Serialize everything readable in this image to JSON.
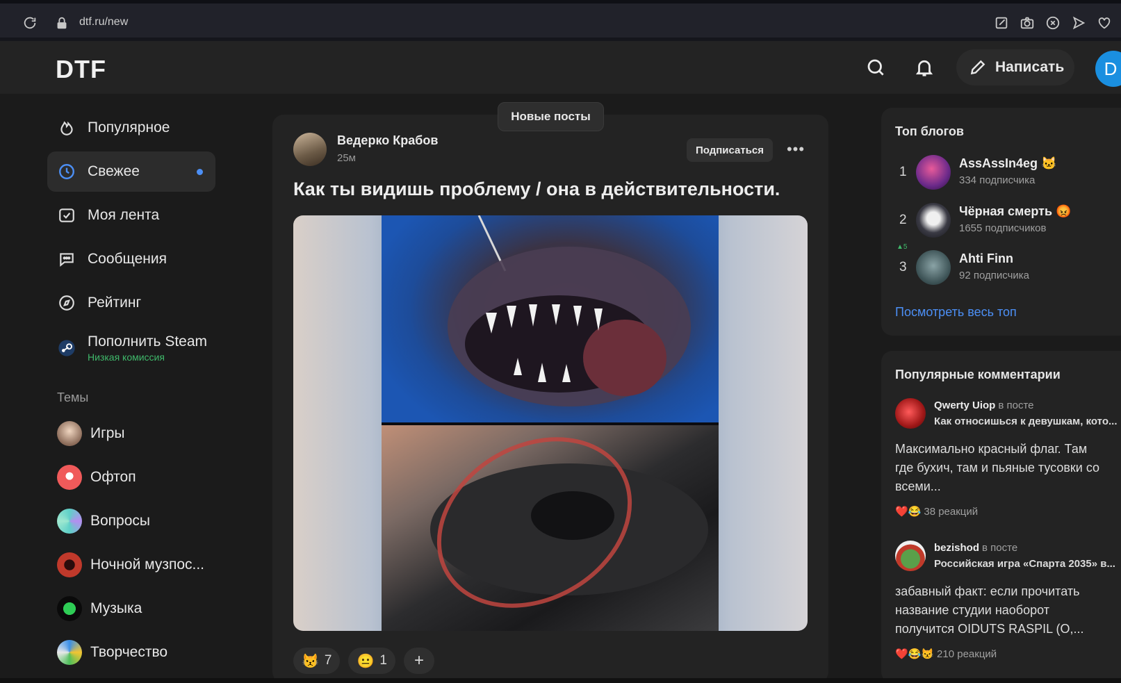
{
  "browser": {
    "url": "dtf.ru/new",
    "icons": [
      "reload-icon",
      "lock-icon",
      "edit-icon",
      "camera-icon",
      "shield-icon",
      "send-icon",
      "heart-icon"
    ]
  },
  "header": {
    "logo": "DTF",
    "write_label": "Написать",
    "avatar_letter": "D"
  },
  "sidebar": {
    "items": [
      {
        "label": "Популярное",
        "icon": "fire-icon"
      },
      {
        "label": "Свежее",
        "icon": "clock-icon",
        "active": true
      },
      {
        "label": "Моя лента",
        "icon": "feed-icon"
      },
      {
        "label": "Сообщения",
        "icon": "chat-icon"
      },
      {
        "label": "Рейтинг",
        "icon": "compass-icon"
      }
    ],
    "steam": {
      "label": "Пополнить Steam",
      "sub": "Низкая комиссия"
    },
    "themes_title": "Темы",
    "topics": [
      {
        "label": "Игры"
      },
      {
        "label": "Офтоп"
      },
      {
        "label": "Вопросы"
      },
      {
        "label": "Ночной музпос..."
      },
      {
        "label": "Музыка"
      },
      {
        "label": "Творчество"
      }
    ]
  },
  "feed": {
    "new_posts_label": "Новые посты",
    "post": {
      "author": "Ведерко Крабов",
      "time": "25м",
      "subscribe_label": "Подписаться",
      "more_label": "•••",
      "title": "Как ты видишь проблему / она в действительности.",
      "reactions": [
        {
          "emoji": "😾",
          "count": "7"
        },
        {
          "emoji": "😐",
          "count": "1"
        }
      ],
      "add_reaction": "+"
    }
  },
  "top_blogs": {
    "title": "Топ блогов",
    "items": [
      {
        "rank": "1",
        "name": "AssAssIn4eg 🐱",
        "subs": "334 подписчика"
      },
      {
        "rank": "2",
        "name": "Чёрная смерть 😡",
        "subs": "1655 подписчиков"
      },
      {
        "rank": "3",
        "name": "Ahti Finn",
        "subs": "92 подписчика",
        "change": "▲5"
      }
    ],
    "see_all": "Посмотреть весь топ"
  },
  "popular_comments": {
    "title": "Популярные комментарии",
    "items": [
      {
        "author": "Qwerty Uiop",
        "in_post": "в посте",
        "post": "Как относишься к девушкам, кото...",
        "text": "Максимально красный флаг. Там где бухич, там и пьяные тусовки со всеми...",
        "emojis": "❤️😂",
        "reactions": "38 реакций"
      },
      {
        "author": "bezishod",
        "in_post": "в посте",
        "post": "Российская игра «Спарта 2035» в...",
        "text": "забавный факт: если прочитать название студии наоборот получится OIDUTS RASPIL (O,...",
        "emojis": "❤️😂😾",
        "reactions": "210 реакций"
      }
    ]
  },
  "colors": {
    "accent": "#4c8ff5",
    "green": "#3fb86a",
    "background": "#1b1b1b",
    "panel": "#232323"
  }
}
